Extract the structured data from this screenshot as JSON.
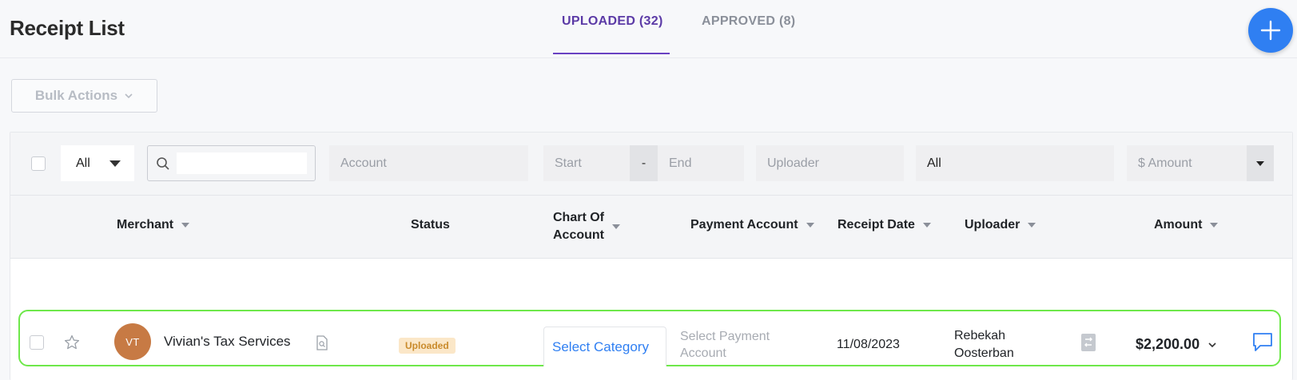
{
  "header": {
    "title": "Receipt List",
    "tabs": [
      {
        "label": "UPLOADED (32)",
        "active": true
      },
      {
        "label": "APPROVED (8)",
        "active": false
      }
    ],
    "add_icon": "plus-icon",
    "accent_color": "#6a41c2",
    "fab_color": "#2f7ff2"
  },
  "toolbar": {
    "bulk_actions_label": "Bulk Actions"
  },
  "filters": {
    "type_select": "All",
    "search_value": "",
    "account_placeholder": "Account",
    "start_placeholder": "Start",
    "range_separator": "-",
    "end_placeholder": "End",
    "uploader_placeholder": "Uploader",
    "status_select": "All",
    "amount_placeholder": "$ Amount"
  },
  "columns": {
    "merchant": "Merchant",
    "status": "Status",
    "chart_of_account_line1": "Chart Of",
    "chart_of_account_line2": "Account",
    "payment_account": "Payment Account",
    "receipt_date": "Receipt Date",
    "uploader": "Uploader",
    "amount": "Amount"
  },
  "rows": [
    {
      "initials": "VT",
      "merchant": "Vivian's Tax Services",
      "status": "Uploaded",
      "chart_of_account": "Select Category",
      "payment_account": "Select Payment Account",
      "receipt_date": "11/08/2023",
      "uploader_line1": "Rebekah",
      "uploader_line2": "Oosterban",
      "amount": "$2,200.00",
      "avatar_color": "#c77a44",
      "status_color": "#c98a2b"
    }
  ]
}
